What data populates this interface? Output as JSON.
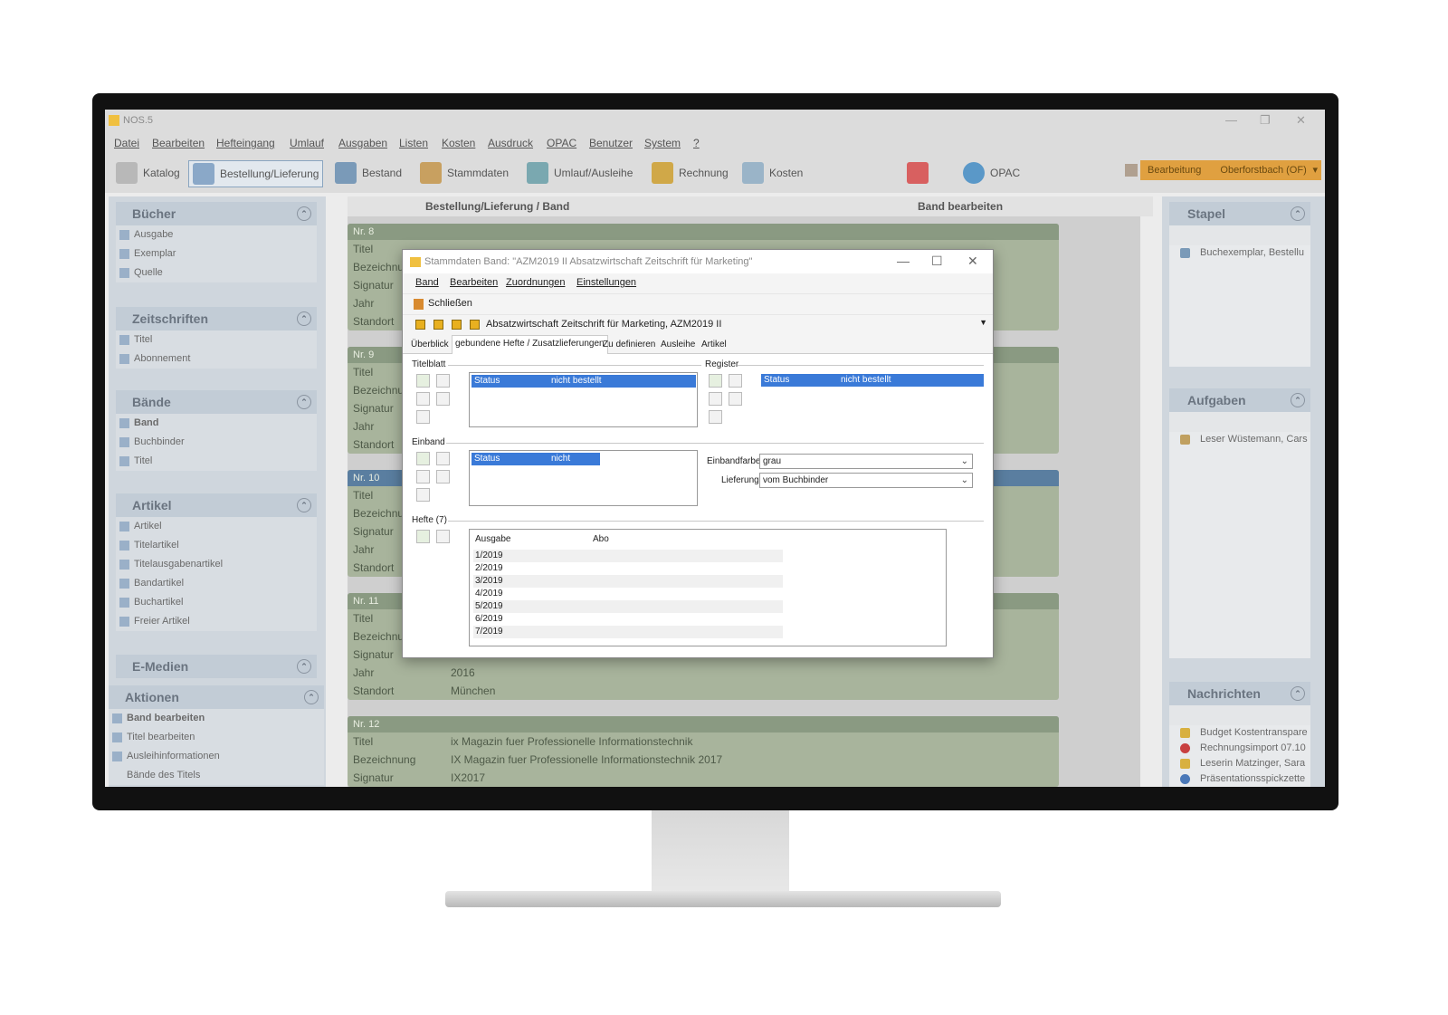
{
  "app": {
    "title": "NOS.5",
    "menu": [
      "Datei",
      "Bearbeiten",
      "Hefteingang",
      "Umlauf",
      "Ausgaben",
      "Listen",
      "Kosten",
      "Ausdruck",
      "OPAC",
      "Benutzer",
      "System",
      "?"
    ],
    "toolbar": [
      "Katalog",
      "Bestellung/Lieferung",
      "Bestand",
      "Stammdaten",
      "Umlauf/Ausleihe",
      "Rechnung",
      "Kosten",
      "OPAC"
    ],
    "mode": "Bearbeitung",
    "location": "Oberforstbach (OF)"
  },
  "left": {
    "buecher": {
      "title": "Bücher",
      "items": [
        "Ausgabe",
        "Exemplar",
        "Quelle"
      ]
    },
    "zeitschriften": {
      "title": "Zeitschriften",
      "items": [
        "Titel",
        "Abonnement"
      ]
    },
    "baende": {
      "title": "Bände",
      "items": [
        "Band",
        "Buchbinder",
        "Titel"
      ]
    },
    "artikel": {
      "title": "Artikel",
      "items": [
        "Artikel",
        "Titelartikel",
        "Titelausgabenartikel",
        "Bandartikel",
        "Buchartikel",
        "Freier Artikel"
      ]
    },
    "emedien": {
      "title": "E-Medien"
    },
    "aktionen": {
      "title": "Aktionen",
      "items": [
        "Band bearbeiten",
        "Titel bearbeiten",
        "Ausleihinformationen",
        "Bände des Titels"
      ]
    }
  },
  "center": {
    "breadcrumb": "Bestellung/Lieferung / Band",
    "panel_title": "Band bearbeiten",
    "labels": {
      "titel": "Titel",
      "bezeichnung": "Bezeichnung",
      "signatur": "Signatur",
      "jahr": "Jahr",
      "standort": "Standort"
    },
    "cards": [
      {
        "nr": "Nr. 8"
      },
      {
        "nr": "Nr. 9"
      },
      {
        "nr": "Nr. 10"
      },
      {
        "nr": "Nr. 11",
        "jahr": "2016",
        "standort": "München"
      },
      {
        "nr": "Nr. 12",
        "titel": "ix Magazin fuer Professionelle Informationstechnik",
        "bezeichnung": "IX Magazin fuer Professionelle Informationstechnik 2017",
        "signatur": "IX2017"
      }
    ]
  },
  "right": {
    "stapel": {
      "title": "Stapel",
      "items": [
        "Buchexemplar, Bestellu"
      ]
    },
    "aufgaben": {
      "title": "Aufgaben",
      "items": [
        "Leser Wüstemann, Cars"
      ]
    },
    "nachrichten": {
      "title": "Nachrichten",
      "items": [
        "Budget Kostentranspare",
        "Rechnungsimport 07.10",
        "Leserin Matzinger, Sara",
        "Präsentationsspickzette"
      ]
    }
  },
  "dialog": {
    "title": "Stammdaten Band: \"AZM2019 II Absatzwirtschaft Zeitschrift für Marketing\"",
    "menu": [
      "Band",
      "Bearbeiten",
      "Zuordnungen",
      "Einstellungen"
    ],
    "close_label": "Schließen",
    "record": "Absatzwirtschaft Zeitschrift für Marketing, AZM2019 II",
    "tabs": [
      "Überblick",
      "gebundene Hefte / Zusatzlieferungen",
      "Zu definieren",
      "Ausleihe",
      "Artikel"
    ],
    "titelblatt": {
      "label": "Titelblatt",
      "status_key": "Status",
      "status_value": "nicht bestellt"
    },
    "register": {
      "label": "Register",
      "status_key": "Status",
      "status_value": "nicht bestellt"
    },
    "einband": {
      "label": "Einband",
      "status_key": "Status",
      "status_value": "nicht bestellt",
      "farbe_label": "Einbandfarbe",
      "farbe_value": "grau",
      "lieferung_label": "Lieferung",
      "lieferung_value": "vom Buchbinder"
    },
    "hefte": {
      "label": "Hefte (7)",
      "col_ausgabe": "Ausgabe",
      "col_abo": "Abo",
      "rows": [
        "1/2019",
        "2/2019",
        "3/2019",
        "4/2019",
        "5/2019",
        "6/2019",
        "7/2019"
      ]
    }
  }
}
